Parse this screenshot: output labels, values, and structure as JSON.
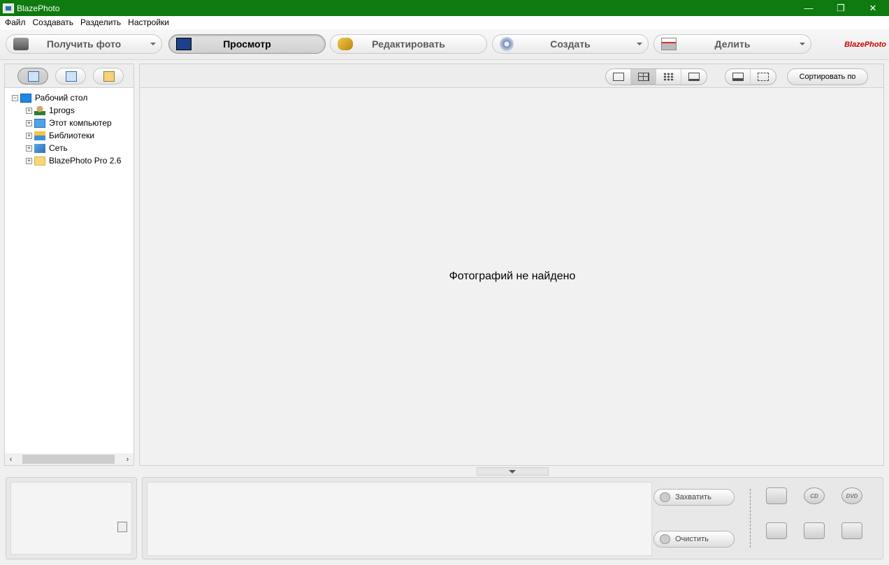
{
  "window": {
    "title": "BlazePhoto",
    "controls": [
      "—",
      "❐",
      "✕"
    ]
  },
  "menu": [
    "Файл",
    "Создавать",
    "Разделить",
    "Настройки"
  ],
  "modules": [
    {
      "label": "Получить фото",
      "icon": "camera-icon",
      "dropdown": true,
      "active": false
    },
    {
      "label": "Просмотр",
      "icon": "photo-view-icon",
      "dropdown": false,
      "active": true
    },
    {
      "label": "Редактировать",
      "icon": "edit-brush-icon",
      "dropdown": false,
      "active": false
    },
    {
      "label": "Создать",
      "icon": "disc-create-icon",
      "dropdown": true,
      "active": false
    },
    {
      "label": "Делить",
      "icon": "printer-share-icon",
      "dropdown": true,
      "active": false
    }
  ],
  "brand": "BlazePhoto",
  "left_tabs": [
    "folders-tab-icon",
    "calendar-tab-icon",
    "albums-tab-icon"
  ],
  "tree": {
    "root": {
      "label": "Рабочий стол",
      "icon": "desktop-icon"
    },
    "children": [
      {
        "label": "1progs",
        "icon": "user-icon"
      },
      {
        "label": "Этот компьютер",
        "icon": "computer-icon"
      },
      {
        "label": "Библиотеки",
        "icon": "library-icon"
      },
      {
        "label": "Сеть",
        "icon": "network-icon"
      },
      {
        "label": "BlazePhoto Pro 2.6",
        "icon": "folder-icon"
      }
    ]
  },
  "view_modes": [
    "preview-icon",
    "large-thumbs-icon",
    "small-thumbs-icon",
    "details-icon"
  ],
  "panel_modes": [
    "single-pane-icon",
    "filmstrip-icon"
  ],
  "sort_label": "Сортировать по",
  "empty_message": "Фотографий не найдено",
  "tray_buttons": {
    "capture": "Захватить",
    "clear": "Очистить"
  },
  "actions": [
    {
      "icon": "print-icon",
      "label": ""
    },
    {
      "icon": "cd-icon",
      "label": "CD"
    },
    {
      "icon": "dvd-icon",
      "label": "DVD"
    },
    {
      "icon": "html-edit-icon",
      "label": ""
    },
    {
      "icon": "email-icon",
      "label": ""
    },
    {
      "icon": "export-icon",
      "label": ""
    }
  ]
}
